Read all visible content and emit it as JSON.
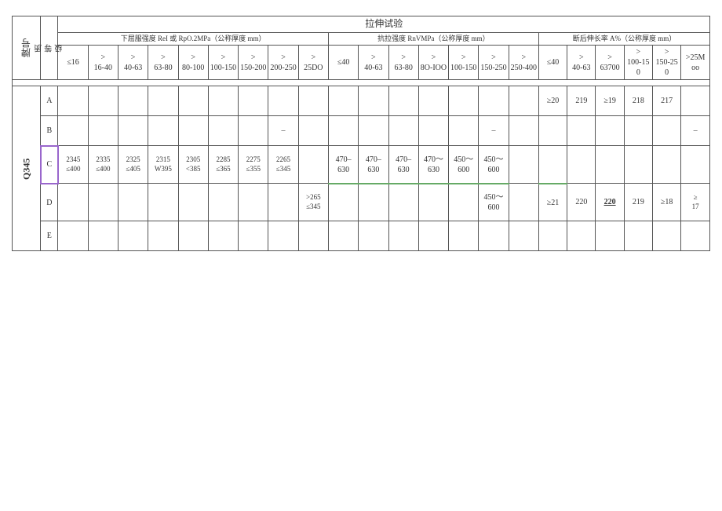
{
  "title": "拉伸试验",
  "sections": {
    "yield_strength": "下屈服强度 ReI 或 RpO.2MPa（公称厚度 mm）",
    "tensile_strength": "抗拉强度 RnVMPa（公称厚度 mm）",
    "elongation": "断后伸长率 A%（公称厚度 mm）"
  },
  "thickness_ranges": {
    "yield": [
      "≤16",
      ">16-40",
      ">40-63",
      ">63-80",
      ">80-100",
      ">100-150",
      ">150-200",
      ">200-250",
      ">25DO"
    ],
    "tensile": [
      "≤40",
      ">40-63",
      ">63-80",
      ">8O-IOO",
      ">100-150",
      ">150-250",
      ">250-400"
    ],
    "elongation": [
      "≤40",
      ">40-63",
      ">63700",
      ">100-150",
      ">150-250",
      ">25M oo"
    ]
  },
  "steel_grade": "Q345",
  "quality_grades": [
    "A",
    "B",
    "C",
    "D",
    "E"
  ],
  "data": {
    "A": {
      "yield": [
        "",
        "",
        "",
        "",
        "",
        "",
        "",
        "",
        ""
      ],
      "tensile": [
        "",
        "",
        "",
        "",
        "",
        "",
        ""
      ],
      "elongation": [
        "≥20",
        "219",
        "≥19",
        "218",
        "217",
        ""
      ]
    },
    "B": {
      "yield": [
        "",
        "",
        "",
        "",
        "",
        "",
        "",
        "",
        ""
      ],
      "tensile": [
        "",
        "",
        "",
        "",
        "",
        "",
        ""
      ],
      "elongation": [
        "",
        "",
        "",
        "",
        "",
        "–"
      ],
      "note_yield": "–",
      "note_tensile": "–"
    },
    "C": {
      "yield": [
        "2345\n≤400",
        "2335\n≤400",
        "2325\n≤405",
        "2315\nW395",
        "2305\n<385",
        "2285\n≤365",
        "2275\n≤355",
        "2265\n≤345",
        ""
      ],
      "tensile": [
        "470–630",
        "470–630",
        "470–630",
        "470～630",
        "450～600",
        "450～600",
        ""
      ],
      "elongation": [
        "",
        "",
        "",
        "",
        "",
        ""
      ]
    },
    "D": {
      "yield": [
        "",
        "",
        "",
        "",
        "",
        "",
        "",
        "",
        ">265\n≤345"
      ],
      "tensile": [
        "",
        "",
        "",
        "",
        "",
        "450～600",
        ""
      ],
      "elongation": [
        "≥21",
        "220",
        "220",
        "219",
        "≥18",
        "≥\n17"
      ]
    },
    "E": {
      "yield": [
        "",
        "",
        "",
        "",
        "",
        "",
        "",
        "",
        ""
      ],
      "tensile": [
        "",
        "",
        "",
        "",
        "",
        "",
        ""
      ],
      "elongation": [
        "",
        "",
        "",
        "",
        "",
        ""
      ]
    }
  }
}
